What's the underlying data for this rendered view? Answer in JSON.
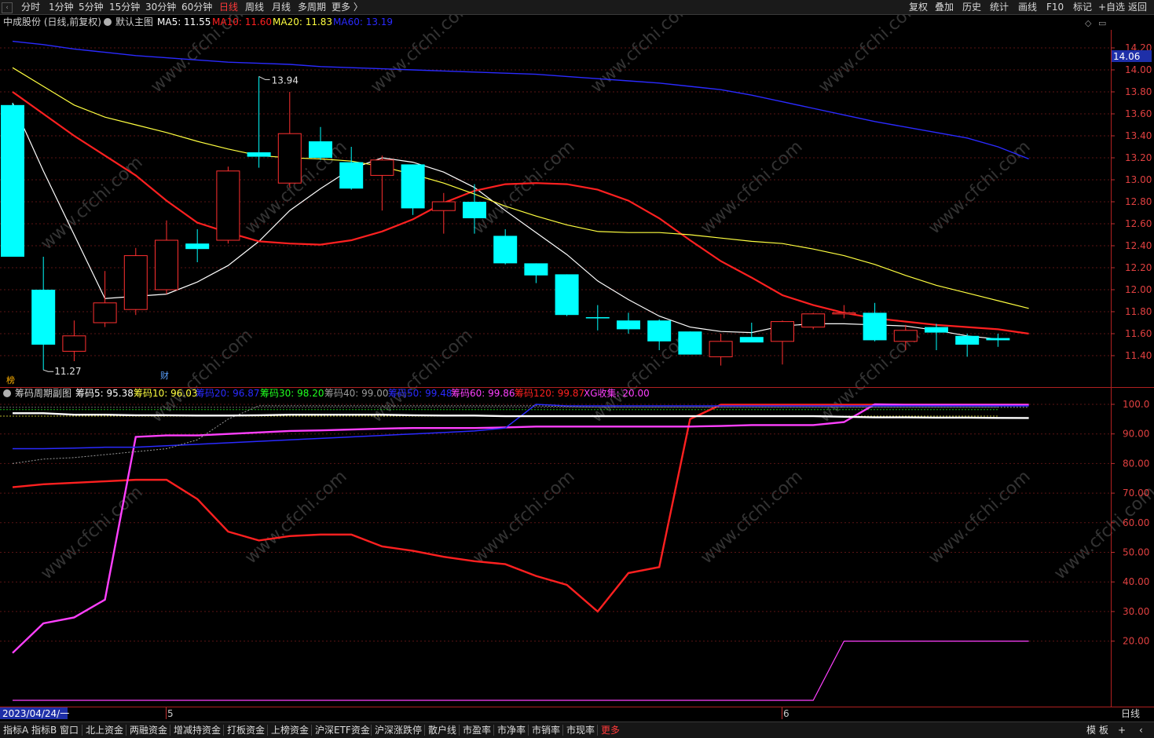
{
  "topbar": {
    "periods": [
      "分时",
      "1分钟",
      "5分钟",
      "15分钟",
      "30分钟",
      "60分钟",
      "日线",
      "周线",
      "月线",
      "多周期",
      "更多 〉"
    ],
    "active_period": "日线",
    "right_buttons": [
      "复权",
      "叠加",
      "历史",
      "统计",
      "画线",
      "F10",
      "标记",
      "+自选",
      "返回"
    ]
  },
  "main": {
    "stock_title": "中成股份 (日线,前复权)",
    "template": "默认主图",
    "ma": [
      {
        "label": "MA5: 11.55",
        "color": "#ffffff"
      },
      {
        "label": "MA10: 11.60",
        "color": "#ff2020"
      },
      {
        "label": "MA20: 11.83",
        "color": "#ffff40"
      },
      {
        "label": "MA60: 13.19",
        "color": "#2a2aff"
      }
    ],
    "price_ticks": [
      "14.20",
      "14.00",
      "13.80",
      "13.60",
      "13.40",
      "13.20",
      "13.00",
      "12.80",
      "12.60",
      "12.40",
      "12.20",
      "12.00",
      "11.80",
      "11.60",
      "11.40"
    ],
    "current_price": "14.06",
    "high_label": "13.94",
    "low_label": "11.27",
    "markers": [
      "榜",
      "财"
    ]
  },
  "sub": {
    "title": "筹码周期副图",
    "indicators": [
      {
        "label": "筹码5: 95.38",
        "color": "#ffffff"
      },
      {
        "label": "筹码10: 96.03",
        "color": "#ffff40"
      },
      {
        "label": "筹码20: 96.87",
        "color": "#2a2aff"
      },
      {
        "label": "筹码30: 98.20",
        "color": "#20ff20"
      },
      {
        "label": "筹码40: 99.00",
        "color": "#9a9a9a"
      },
      {
        "label": "筹码50: 99.48",
        "color": "#2a2aff"
      },
      {
        "label": "筹码60: 99.86",
        "color": "#ff40ff"
      },
      {
        "label": "筹码120: 99.87",
        "color": "#ff2020"
      },
      {
        "label": "XG收集: 20.00",
        "color": "#ff40ff"
      }
    ],
    "ticks": [
      "100.0",
      "90.00",
      "80.00",
      "70.00",
      "60.00",
      "50.00",
      "40.00",
      "30.00",
      "20.00"
    ]
  },
  "xaxis": {
    "start_date": "2023/04/24/一",
    "month_labels": [
      "5",
      "6"
    ],
    "period_label": "日线"
  },
  "bottombar": {
    "tabs": [
      "指标A",
      "指标B",
      "窗口",
      "北上资金",
      "两融资金",
      "增减持资金",
      "打板资金",
      "上榜资金",
      "沪深ETF资金",
      "沪深涨跌停",
      "散户线",
      "市盈率",
      "市净率",
      "市销率",
      "市现率",
      "更多"
    ],
    "right": [
      "模",
      "板",
      "+",
      "‹"
    ]
  },
  "watermark": "www.cfchi.com",
  "chart_data": [
    {
      "type": "candlestick",
      "title": "中成股份 (日线,前复权)",
      "ylim": [
        11.27,
        14.2
      ],
      "candles": [
        {
          "o": 13.68,
          "h": 13.7,
          "l": 12.3,
          "c": 12.3
        },
        {
          "o": 12.0,
          "h": 12.3,
          "l": 11.27,
          "c": 11.5
        },
        {
          "o": 11.44,
          "h": 11.72,
          "l": 11.35,
          "c": 11.58
        },
        {
          "o": 11.7,
          "h": 12.17,
          "l": 11.66,
          "c": 11.88
        },
        {
          "o": 11.82,
          "h": 12.38,
          "l": 11.77,
          "c": 12.31
        },
        {
          "o": 12.0,
          "h": 12.63,
          "l": 11.96,
          "c": 12.45
        },
        {
          "o": 12.42,
          "h": 12.55,
          "l": 12.25,
          "c": 12.37
        },
        {
          "o": 12.45,
          "h": 13.12,
          "l": 12.42,
          "c": 13.08
        },
        {
          "o": 13.25,
          "h": 13.94,
          "l": 13.11,
          "c": 13.21
        },
        {
          "o": 12.97,
          "h": 13.8,
          "l": 12.93,
          "c": 13.42
        },
        {
          "o": 13.35,
          "h": 13.48,
          "l": 13.18,
          "c": 13.2
        },
        {
          "o": 13.16,
          "h": 13.3,
          "l": 12.91,
          "c": 12.92
        },
        {
          "o": 13.04,
          "h": 13.22,
          "l": 12.72,
          "c": 13.18
        },
        {
          "o": 13.14,
          "h": 13.14,
          "l": 12.68,
          "c": 12.74
        },
        {
          "o": 12.72,
          "h": 12.88,
          "l": 12.51,
          "c": 12.8
        },
        {
          "o": 12.8,
          "h": 12.96,
          "l": 12.51,
          "c": 12.65
        },
        {
          "o": 12.49,
          "h": 12.55,
          "l": 12.23,
          "c": 12.24
        },
        {
          "o": 12.24,
          "h": 12.24,
          "l": 12.06,
          "c": 12.13
        },
        {
          "o": 12.14,
          "h": 12.14,
          "l": 11.76,
          "c": 11.77
        },
        {
          "o": 11.75,
          "h": 11.86,
          "l": 11.63,
          "c": 11.74
        },
        {
          "o": 11.72,
          "h": 11.79,
          "l": 11.6,
          "c": 11.64
        },
        {
          "o": 11.72,
          "h": 11.73,
          "l": 11.45,
          "c": 11.53
        },
        {
          "o": 11.62,
          "h": 11.62,
          "l": 11.41,
          "c": 11.41
        },
        {
          "o": 11.39,
          "h": 11.6,
          "l": 11.31,
          "c": 11.53
        },
        {
          "o": 11.57,
          "h": 11.7,
          "l": 11.53,
          "c": 11.52
        },
        {
          "o": 11.53,
          "h": 11.72,
          "l": 11.32,
          "c": 11.71
        },
        {
          "o": 11.66,
          "h": 11.79,
          "l": 11.64,
          "c": 11.78
        },
        {
          "o": 11.78,
          "h": 11.86,
          "l": 11.74,
          "c": 11.79
        },
        {
          "o": 11.79,
          "h": 11.88,
          "l": 11.53,
          "c": 11.54
        },
        {
          "o": 11.53,
          "h": 11.68,
          "l": 11.45,
          "c": 11.63
        },
        {
          "o": 11.66,
          "h": 11.69,
          "l": 11.45,
          "c": 11.61
        },
        {
          "o": 11.58,
          "h": 11.6,
          "l": 11.39,
          "c": 11.5
        },
        {
          "o": 11.56,
          "h": 11.6,
          "l": 11.48,
          "c": 11.54
        }
      ],
      "series": [
        {
          "name": "MA5",
          "color": "#ffffff",
          "values": [
            13.7,
            13.08,
            12.5,
            11.92,
            11.94,
            11.96,
            12.07,
            12.22,
            12.44,
            12.72,
            12.92,
            13.1,
            13.2,
            13.16,
            13.07,
            12.93,
            12.72,
            12.52,
            12.32,
            12.08,
            11.91,
            11.76,
            11.66,
            11.62,
            11.61,
            11.67,
            11.69,
            11.69,
            11.68,
            11.67,
            11.63,
            11.58,
            11.55
          ]
        },
        {
          "name": "MA10",
          "color": "#ff2020",
          "values": [
            13.8,
            13.6,
            13.4,
            13.22,
            13.04,
            12.81,
            12.61,
            12.52,
            12.44,
            12.42,
            12.41,
            12.45,
            12.53,
            12.64,
            12.79,
            12.9,
            12.96,
            12.97,
            12.96,
            12.91,
            12.81,
            12.65,
            12.45,
            12.26,
            12.11,
            11.95,
            11.86,
            11.79,
            11.74,
            11.71,
            11.68,
            11.66,
            11.64,
            11.6
          ]
        },
        {
          "name": "MA20",
          "color": "#ffff40",
          "values": [
            14.02,
            13.85,
            13.68,
            13.57,
            13.5,
            13.43,
            13.35,
            13.28,
            13.22,
            13.2,
            13.19,
            13.17,
            13.12,
            13.05,
            12.97,
            12.87,
            12.76,
            12.67,
            12.59,
            12.53,
            12.52,
            12.52,
            12.5,
            12.47,
            12.44,
            12.42,
            12.37,
            12.31,
            12.23,
            12.13,
            12.04,
            11.97,
            11.9,
            11.83
          ]
        },
        {
          "name": "MA60",
          "color": "#2a2aff",
          "values": [
            14.26,
            14.23,
            14.19,
            14.16,
            14.13,
            14.11,
            14.09,
            14.07,
            14.06,
            14.05,
            14.03,
            14.02,
            14.01,
            14.0,
            13.99,
            13.98,
            13.97,
            13.96,
            13.94,
            13.92,
            13.9,
            13.88,
            13.85,
            13.82,
            13.77,
            13.71,
            13.65,
            13.59,
            13.53,
            13.48,
            13.43,
            13.38,
            13.3,
            13.19
          ]
        }
      ]
    },
    {
      "type": "line",
      "title": "筹码周期副图",
      "ylim": [
        0,
        100
      ],
      "series": [
        {
          "name": "筹码120",
          "color": "#ff2020",
          "values": [
            72,
            73,
            73.5,
            74,
            74.5,
            74.5,
            68,
            57,
            54,
            55.5,
            56,
            56,
            52,
            50.5,
            48.5,
            47,
            46,
            42,
            39,
            30,
            43,
            45,
            95,
            99.87,
            99.87,
            99.87,
            99.87,
            99.87,
            99.87,
            99.87,
            99.87,
            99.87,
            99.87,
            99.87
          ]
        },
        {
          "name": "筹码60",
          "color": "#ff40ff",
          "values": [
            16,
            26,
            28,
            34,
            89,
            89.5,
            89.5,
            90,
            90.5,
            91,
            91.2,
            91.5,
            91.8,
            92,
            92,
            92,
            92.2,
            92.5,
            92.5,
            92.5,
            92.5,
            92.5,
            92.5,
            92.7,
            93,
            93,
            93,
            94,
            100,
            99.86,
            99.86,
            99.86,
            99.86,
            99.86
          ]
        },
        {
          "name": "筹码50",
          "color": "#2a2aff",
          "values": [
            85,
            85,
            85.2,
            85.5,
            85.5,
            86,
            86.5,
            87,
            87.5,
            88,
            88.5,
            89,
            89.5,
            90,
            90.5,
            91,
            92,
            100,
            99.48,
            99.48,
            99.48,
            99.48,
            99.48,
            99.48,
            99.48,
            99.48,
            99.48,
            99.48,
            99.48,
            99.48,
            99.48,
            99.48,
            99.48,
            99.48
          ]
        },
        {
          "name": "筹码40",
          "color": "#9a9a9a",
          "values": [
            80,
            81.5,
            82,
            83,
            84,
            85,
            88,
            95,
            99.5,
            99.5,
            99.5,
            99.5,
            99.5,
            99.5,
            99.5,
            99.5,
            99.5,
            99.5,
            99.2,
            99,
            99,
            99,
            99,
            99,
            99,
            99,
            99,
            99,
            99,
            99,
            99,
            99,
            99,
            99
          ]
        },
        {
          "name": "筹码5",
          "color": "#ffffff",
          "values": [
            97,
            97,
            96.5,
            96.5,
            96.3,
            96.3,
            96.2,
            96.2,
            96.3,
            96.5,
            96.5,
            96.5,
            96.5,
            96.3,
            96.2,
            96.2,
            96,
            96,
            96,
            96,
            96,
            96,
            96,
            96,
            96,
            96,
            96,
            95.8,
            95.6,
            95.6,
            95.5,
            95.5,
            95.4,
            95.38
          ]
        },
        {
          "name": "XG收集",
          "color": "#ff40ff",
          "values": [
            0,
            0,
            0,
            0,
            0,
            0,
            0,
            0,
            0,
            0,
            0,
            0,
            0,
            0,
            0,
            0,
            0,
            0,
            0,
            0,
            0,
            0,
            0,
            0,
            0,
            0,
            0,
            20,
            20,
            20,
            20,
            20,
            20,
            20
          ]
        }
      ]
    }
  ]
}
